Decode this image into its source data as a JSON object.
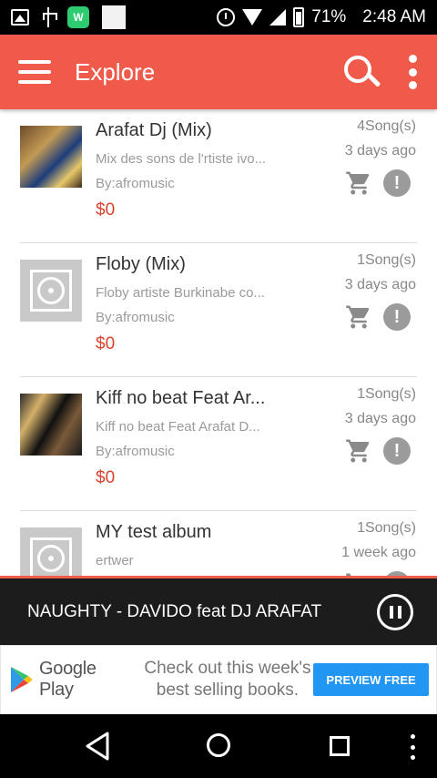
{
  "status_bar": {
    "icons": [
      "image-icon",
      "usb-icon",
      "app-notification-icon",
      "blank-square-icon",
      "alarm-icon",
      "wifi-icon",
      "signal-icon",
      "battery-icon"
    ],
    "battery": "71%",
    "time": "2:48 AM"
  },
  "app_bar": {
    "title": "Explore",
    "color": "#ef5a4a"
  },
  "albums": [
    {
      "title": "Arafat Dj (Mix)",
      "description": "Mix des sons de l'rtiste ivo...",
      "by": "By:afromusic",
      "price": "$0",
      "songs": "4Song(s)",
      "date": "3 days ago"
    },
    {
      "title": "Floby (Mix)",
      "description": "Floby artiste Burkinabe co...",
      "by": "By:afromusic",
      "price": "$0",
      "songs": "1Song(s)",
      "date": "3 days ago"
    },
    {
      "title": "Kiff no beat Feat Ar...",
      "description": "Kiff no beat Feat Arafat D...",
      "by": "By:afromusic",
      "price": "$0",
      "songs": "1Song(s)",
      "date": "3 days ago"
    },
    {
      "title": "MY test album",
      "description": "ertwer",
      "songs": "1Song(s)",
      "date": "1 week ago"
    }
  ],
  "player": {
    "track": "NAUGHTY - DAVIDO feat DJ ARAFAT"
  },
  "ad": {
    "store": "Google Play",
    "line1": "Check out this week's",
    "line2": "best selling books.",
    "button": "PREVIEW FREE"
  }
}
